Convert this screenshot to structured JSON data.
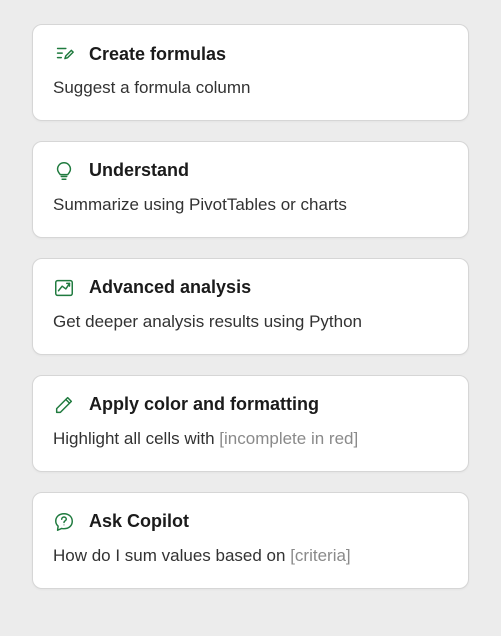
{
  "accent": "#1f7a3e",
  "cards": [
    {
      "icon": "formula-edit-icon",
      "title": "Create formulas",
      "desc": "Suggest a formula column",
      "hint": ""
    },
    {
      "icon": "lightbulb-icon",
      "title": "Understand",
      "desc": "Summarize using PivotTables or charts",
      "hint": ""
    },
    {
      "icon": "analysis-icon",
      "title": "Advanced analysis",
      "desc": "Get deeper analysis results using Python",
      "hint": ""
    },
    {
      "icon": "pencil-icon",
      "title": "Apply color and formatting",
      "desc": "Highlight all cells with ",
      "hint": "[incomplete in red]"
    },
    {
      "icon": "question-chat-icon",
      "title": "Ask Copilot",
      "desc": "How do I sum values based on ",
      "hint": "[criteria]"
    }
  ]
}
